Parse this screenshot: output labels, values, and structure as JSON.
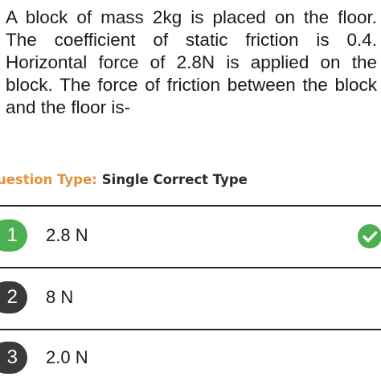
{
  "question": {
    "text": "A block of mass 2kg is placed on the floor. The coefficient of static friction is 0.4. Horizontal force of 2.8N is applied on the block. The force of friction between the block and the floor is-"
  },
  "question_type": {
    "label": "uestion Type:",
    "value": "Single Correct Type"
  },
  "options": [
    {
      "number": "1",
      "text": "2.8 N",
      "correct": true
    },
    {
      "number": "2",
      "text": "8 N",
      "correct": false
    },
    {
      "number": "3",
      "text": "2.0 N",
      "correct": false
    }
  ],
  "colors": {
    "accent": "#e3923a",
    "correct": "#4caf50",
    "badge": "#3a3a3a"
  },
  "icons": {
    "correct_marker": "check-circle-icon"
  }
}
